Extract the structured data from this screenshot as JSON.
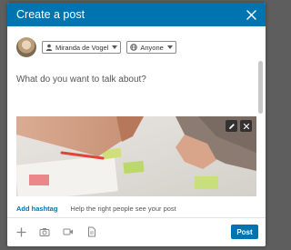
{
  "modal": {
    "title": "Create a post"
  },
  "poster": {
    "name_selector": "Miranda de Vogel",
    "visibility_selector": "Anyone"
  },
  "composer": {
    "placeholder": "What do you want to talk about?"
  },
  "hashtag": {
    "link_label": "Add hashtag",
    "help_text": "Help the right people see your post"
  },
  "toolbar": {
    "post_label": "Post",
    "icons": [
      "plus-icon",
      "camera-icon",
      "video-icon",
      "document-icon"
    ]
  },
  "colors": {
    "brand": "#0073b1",
    "backdrop": "#5e5e5e"
  }
}
